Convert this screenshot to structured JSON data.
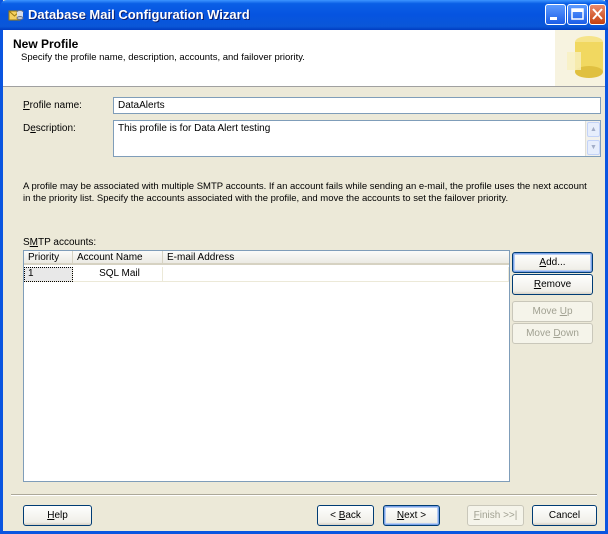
{
  "window": {
    "title": "Database Mail Configuration Wizard"
  },
  "header": {
    "title": "New Profile",
    "subtitle": "Specify the profile name, description, accounts, and failover priority."
  },
  "form": {
    "profile_name_label": "Profile name:",
    "profile_name_value": "DataAlerts",
    "description_label": "Description:",
    "description_value": "This profile is for Data Alert testing"
  },
  "info": {
    "text": "A profile may be associated with multiple SMTP accounts. If an account fails while sending an e-mail, the profile uses the next account in the priority list. Specify the accounts associated with the profile, and move the accounts to set the failover priority."
  },
  "smtp": {
    "label": "SMTP accounts:",
    "columns": [
      "Priority",
      "Account Name",
      "E-mail Address"
    ],
    "rows": [
      {
        "priority": "1",
        "account_name": "SQL Mail",
        "email": ""
      }
    ]
  },
  "side_buttons": {
    "add": "Add...",
    "remove": "Remove",
    "move_up": "Move Up",
    "move_down": "Move Down"
  },
  "footer": {
    "help": "Help",
    "back": "< Back",
    "next": "Next >",
    "finish": "Finish >>|",
    "cancel": "Cancel"
  },
  "colors": {
    "titlebar": "#0654e0",
    "window_bg": "#ece9d8",
    "button_border": "#003c74"
  }
}
